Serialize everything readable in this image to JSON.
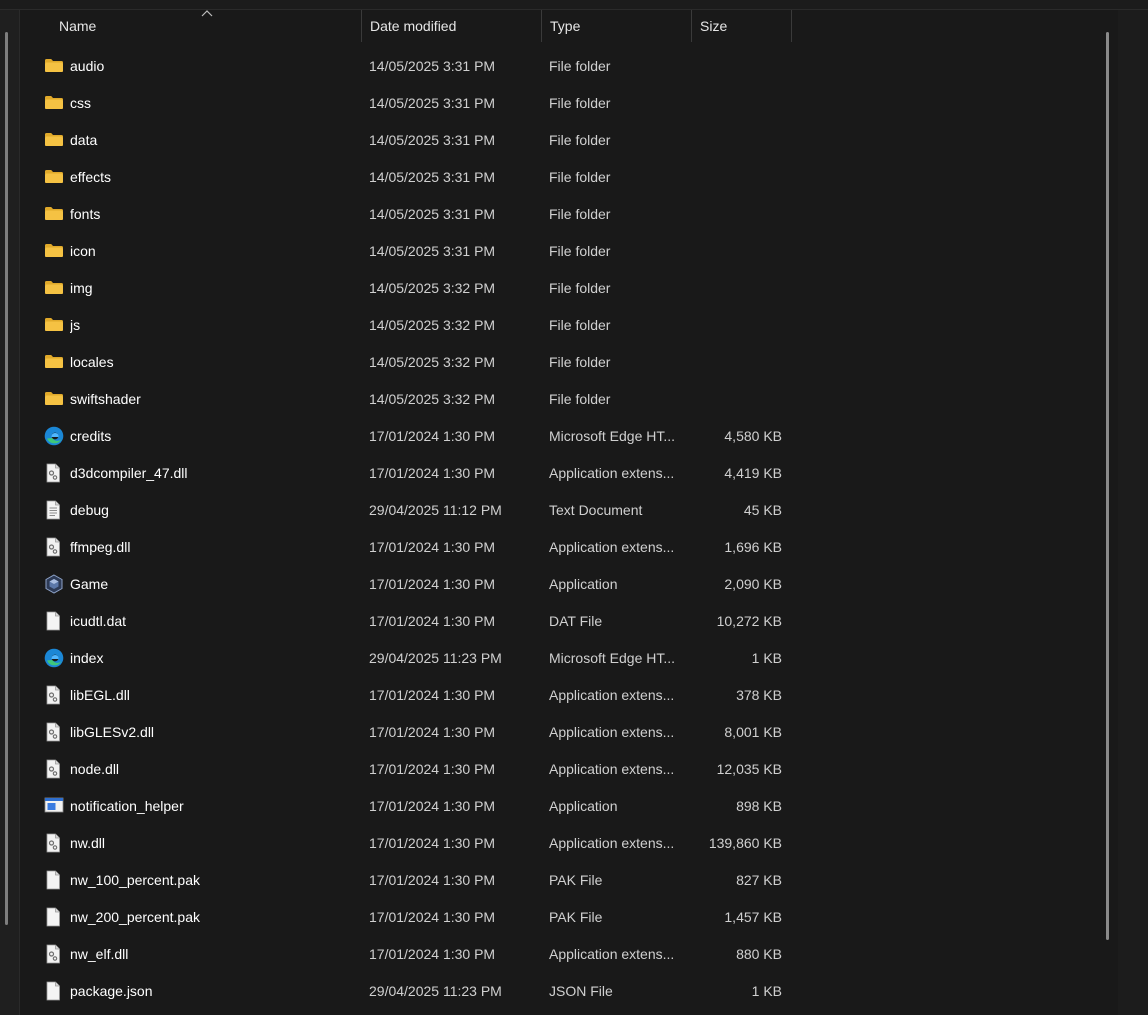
{
  "header": {
    "name": "Name",
    "date_modified": "Date modified",
    "type": "Type",
    "size": "Size"
  },
  "files": [
    {
      "icon": "folder-icon",
      "name": "audio",
      "date": "14/05/2025 3:31 PM",
      "type": "File folder",
      "size": ""
    },
    {
      "icon": "folder-icon",
      "name": "css",
      "date": "14/05/2025 3:31 PM",
      "type": "File folder",
      "size": ""
    },
    {
      "icon": "folder-icon",
      "name": "data",
      "date": "14/05/2025 3:31 PM",
      "type": "File folder",
      "size": ""
    },
    {
      "icon": "folder-icon",
      "name": "effects",
      "date": "14/05/2025 3:31 PM",
      "type": "File folder",
      "size": ""
    },
    {
      "icon": "folder-icon",
      "name": "fonts",
      "date": "14/05/2025 3:31 PM",
      "type": "File folder",
      "size": ""
    },
    {
      "icon": "folder-icon",
      "name": "icon",
      "date": "14/05/2025 3:31 PM",
      "type": "File folder",
      "size": ""
    },
    {
      "icon": "folder-icon",
      "name": "img",
      "date": "14/05/2025 3:32 PM",
      "type": "File folder",
      "size": ""
    },
    {
      "icon": "folder-icon",
      "name": "js",
      "date": "14/05/2025 3:32 PM",
      "type": "File folder",
      "size": ""
    },
    {
      "icon": "folder-icon",
      "name": "locales",
      "date": "14/05/2025 3:32 PM",
      "type": "File folder",
      "size": ""
    },
    {
      "icon": "folder-icon",
      "name": "swiftshader",
      "date": "14/05/2025 3:32 PM",
      "type": "File folder",
      "size": ""
    },
    {
      "icon": "edge-html-icon",
      "name": "credits",
      "date": "17/01/2024 1:30 PM",
      "type": "Microsoft Edge HT...",
      "size": "4,580 KB"
    },
    {
      "icon": "dll-file-icon",
      "name": "d3dcompiler_47.dll",
      "date": "17/01/2024 1:30 PM",
      "type": "Application extens...",
      "size": "4,419 KB"
    },
    {
      "icon": "text-document-icon",
      "name": "debug",
      "date": "29/04/2025 11:12 PM",
      "type": "Text Document",
      "size": "45 KB"
    },
    {
      "icon": "dll-file-icon",
      "name": "ffmpeg.dll",
      "date": "17/01/2024 1:30 PM",
      "type": "Application extens...",
      "size": "1,696 KB"
    },
    {
      "icon": "game-app-icon",
      "name": "Game",
      "date": "17/01/2024 1:30 PM",
      "type": "Application",
      "size": "2,090 KB"
    },
    {
      "icon": "blank-file-icon",
      "name": "icudtl.dat",
      "date": "17/01/2024 1:30 PM",
      "type": "DAT File",
      "size": "10,272 KB"
    },
    {
      "icon": "edge-html-icon",
      "name": "index",
      "date": "29/04/2025 11:23 PM",
      "type": "Microsoft Edge HT...",
      "size": "1 KB"
    },
    {
      "icon": "dll-file-icon",
      "name": "libEGL.dll",
      "date": "17/01/2024 1:30 PM",
      "type": "Application extens...",
      "size": "378 KB"
    },
    {
      "icon": "dll-file-icon",
      "name": "libGLESv2.dll",
      "date": "17/01/2024 1:30 PM",
      "type": "Application extens...",
      "size": "8,001 KB"
    },
    {
      "icon": "dll-file-icon",
      "name": "node.dll",
      "date": "17/01/2024 1:30 PM",
      "type": "Application extens...",
      "size": "12,035 KB"
    },
    {
      "icon": "app-window-icon",
      "name": "notification_helper",
      "date": "17/01/2024 1:30 PM",
      "type": "Application",
      "size": "898 KB"
    },
    {
      "icon": "dll-file-icon",
      "name": "nw.dll",
      "date": "17/01/2024 1:30 PM",
      "type": "Application extens...",
      "size": "139,860 KB"
    },
    {
      "icon": "blank-file-icon",
      "name": "nw_100_percent.pak",
      "date": "17/01/2024 1:30 PM",
      "type": "PAK File",
      "size": "827 KB"
    },
    {
      "icon": "blank-file-icon",
      "name": "nw_200_percent.pak",
      "date": "17/01/2024 1:30 PM",
      "type": "PAK File",
      "size": "1,457 KB"
    },
    {
      "icon": "dll-file-icon",
      "name": "nw_elf.dll",
      "date": "17/01/2024 1:30 PM",
      "type": "Application extens...",
      "size": "880 KB"
    },
    {
      "icon": "blank-file-icon",
      "name": "package.json",
      "date": "29/04/2025 11:23 PM",
      "type": "JSON File",
      "size": "1 KB"
    }
  ],
  "colors": {
    "background": "#191919",
    "folder": "#f5c243",
    "folder_dark": "#e0a92a",
    "edge_blue": "#1b87d6",
    "edge_green": "#3fc77a"
  }
}
